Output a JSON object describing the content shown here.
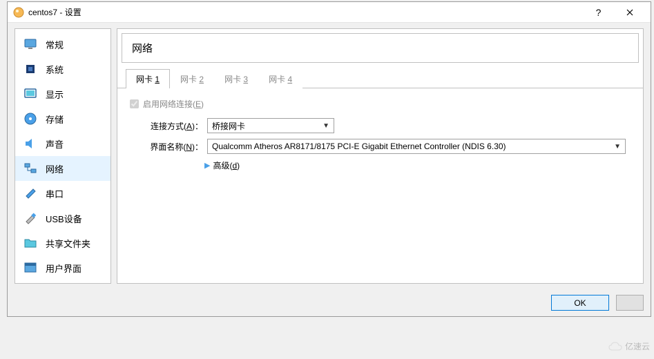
{
  "title": "centos7 - 设置",
  "sidebar": {
    "items": [
      {
        "label": "常规"
      },
      {
        "label": "系统"
      },
      {
        "label": "显示"
      },
      {
        "label": "存储"
      },
      {
        "label": "声音"
      },
      {
        "label": "网络"
      },
      {
        "label": "串口"
      },
      {
        "label": "USB设备"
      },
      {
        "label": "共享文件夹"
      },
      {
        "label": "用户界面"
      }
    ]
  },
  "panel": {
    "title": "网络",
    "tabs": [
      {
        "prefix": "网卡 ",
        "key": "1"
      },
      {
        "prefix": "网卡 ",
        "key": "2"
      },
      {
        "prefix": "网卡 ",
        "key": "3"
      },
      {
        "prefix": "网卡 ",
        "key": "4"
      }
    ],
    "enable_label_prefix": "启用网络连接(",
    "enable_label_key": "E",
    "enable_label_suffix": ")",
    "attach_label_prefix": "连接方式(",
    "attach_label_key": "A",
    "attach_label_suffix": ")：",
    "attach_value": "桥接网卡",
    "name_label_prefix": "界面名称(",
    "name_label_key": "N",
    "name_label_suffix": ")：",
    "name_value": "Qualcomm Atheros AR8171/8175 PCI-E Gigabit Ethernet Controller (NDIS 6.30)",
    "advanced_prefix": "高级(",
    "advanced_key": "d",
    "advanced_suffix": ")"
  },
  "buttons": {
    "ok": "OK"
  },
  "watermark": "亿速云"
}
